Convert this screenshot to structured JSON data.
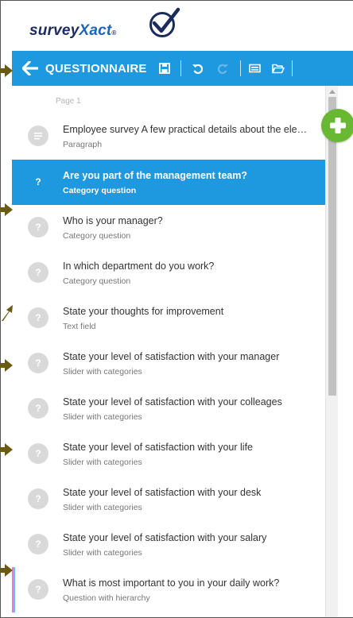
{
  "app": {
    "logo_main": "survey",
    "logo_accent": "Xact"
  },
  "toolbar": {
    "title": "QUESTIONNAIRE",
    "icons": [
      "back-arrow-icon",
      "save-icon",
      "undo-icon",
      "redo-icon",
      "keyboard-icon",
      "folder-icon"
    ]
  },
  "list": {
    "page_label": "Page 1",
    "items": [
      {
        "badge": "",
        "icon": "paragraph-icon",
        "title": "Employee survey   A few practical details about the ele…",
        "type": "Paragraph",
        "selected": false
      },
      {
        "badge": "?",
        "title": "Are you part of the management team?",
        "type": "Category question",
        "selected": true
      },
      {
        "badge": "?",
        "title": "Who is your manager?",
        "type": "Category question",
        "selected": false
      },
      {
        "badge": "?",
        "title": "In which department do you work?",
        "type": "Category question",
        "selected": false
      },
      {
        "badge": "?",
        "title": "State your thoughts for improvement",
        "type": "Text field",
        "selected": false
      },
      {
        "badge": "?",
        "title": "State your level of satisfaction with your manager",
        "type": "Slider with categories",
        "selected": false
      },
      {
        "badge": "?",
        "title": "State your level of satisfaction with your colleages",
        "type": "Slider with categories",
        "selected": false
      },
      {
        "badge": "?",
        "title": "State your level of satisfaction with your life",
        "type": "Slider with categories",
        "selected": false
      },
      {
        "badge": "?",
        "title": "State your level of satisfaction with your desk",
        "type": "Slider with categories",
        "selected": false
      },
      {
        "badge": "?",
        "title": "State your level of satisfaction with your salary",
        "type": "Slider with categories",
        "selected": false
      },
      {
        "badge": "?",
        "title": "What is most important to you in your daily work?",
        "type": "Question with hierarchy",
        "selected": false
      }
    ]
  },
  "colors": {
    "toolbar": "#1e98de",
    "selected_row": "#1e98de",
    "add_button": "#68b832",
    "pointer": "#6b5a12",
    "badge": "#d9d9d9"
  }
}
